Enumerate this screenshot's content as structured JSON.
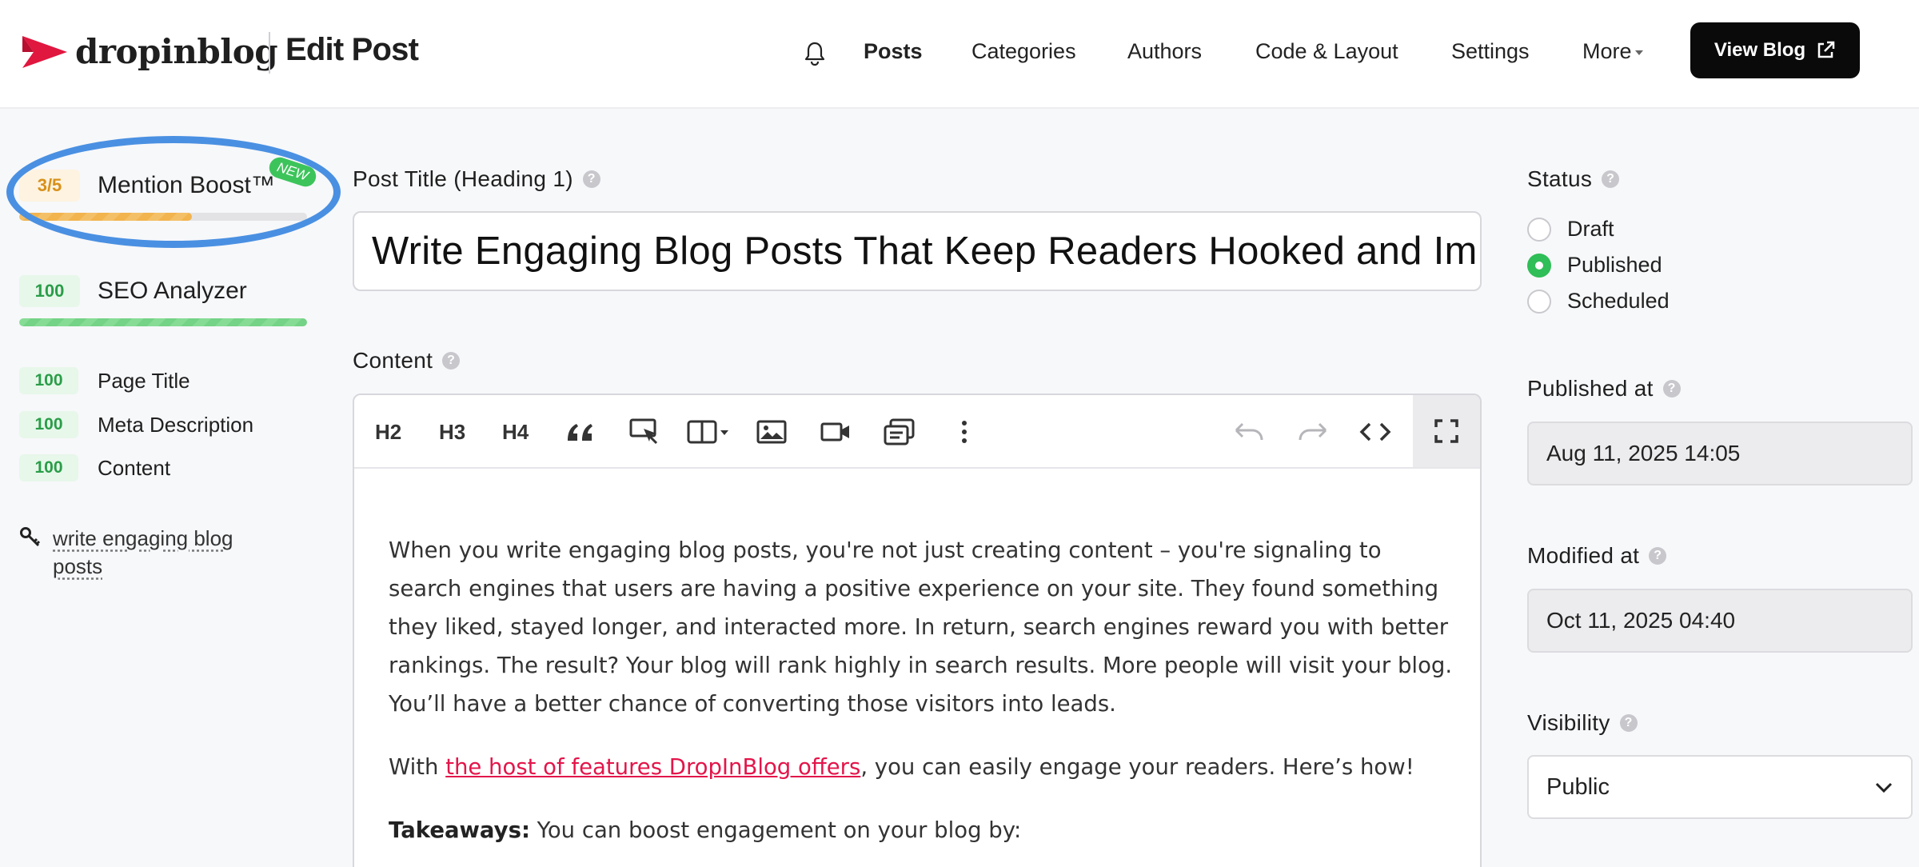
{
  "header": {
    "brand": "dropinblog",
    "page_title": "Edit Post",
    "nav": [
      {
        "label": "Posts",
        "active": true
      },
      {
        "label": "Categories"
      },
      {
        "label": "Authors"
      },
      {
        "label": "Code & Layout"
      },
      {
        "label": "Settings"
      },
      {
        "label": "More"
      }
    ],
    "view_blog_label": "View Blog",
    "icons": {
      "notifications": "bell-icon",
      "external": "external-link-icon"
    },
    "colors": {
      "brand_red": "#e0173f",
      "button_bg": "#0a0a0a"
    }
  },
  "left_panel": {
    "mention_boost": {
      "score": "3/5",
      "label": "Mention Boost™",
      "tag": "NEW",
      "progress": 0.6
    },
    "seo_analyzer": {
      "score": "100",
      "label": "SEO Analyzer",
      "progress": 1.0
    },
    "checks": [
      {
        "score": "100",
        "label": "Page Title"
      },
      {
        "score": "100",
        "label": "Meta Description"
      },
      {
        "score": "100",
        "label": "Content"
      }
    ],
    "keyword": "write engaging blog posts",
    "colors": {
      "amber": "#d8901a",
      "green": "#2a9d48",
      "highlight": "#4a90e2"
    }
  },
  "main": {
    "post_title_label": "Post Title (Heading 1)",
    "post_title_value": "Write Engaging Blog Posts That Keep Readers Hooked and Im",
    "content_label": "Content",
    "toolbar": {
      "h2": "H2",
      "h3": "H3",
      "h4": "H4",
      "icons": [
        "blockquote-icon",
        "call-to-action-icon",
        "columns-icon",
        "image-icon",
        "video-icon",
        "embed-icon",
        "more-options-icon",
        "undo-icon",
        "redo-icon",
        "source-code-icon",
        "fullscreen-icon"
      ]
    },
    "content": {
      "p1": "When you write engaging blog posts, you're not just creating content – you're signaling to search engines that users are having a positive experience on your site. They found something they liked, stayed longer, and interacted more. In return, search engines reward you with better rankings. The result? Your blog will rank highly in search results. More people will visit your blog. You’ll have a better chance of converting those visitors into leads.",
      "p2_before": "With ",
      "p2_link": "the host of features DropInBlog offers",
      "p2_after": ", you can easily engage your readers. Here’s how!",
      "p3_bold": "Takeaways:",
      "p3_rest": " You can boost engagement on your blog by:"
    }
  },
  "right_panel": {
    "status_label": "Status",
    "status_options": [
      {
        "label": "Draft",
        "checked": false
      },
      {
        "label": "Published",
        "checked": true
      },
      {
        "label": "Scheduled",
        "checked": false
      }
    ],
    "published_at_label": "Published at",
    "published_at_value": "Aug 11, 2025 14:05",
    "modified_at_label": "Modified at",
    "modified_at_value": "Oct 11, 2025 04:40",
    "visibility_label": "Visibility",
    "visibility_value": "Public"
  }
}
